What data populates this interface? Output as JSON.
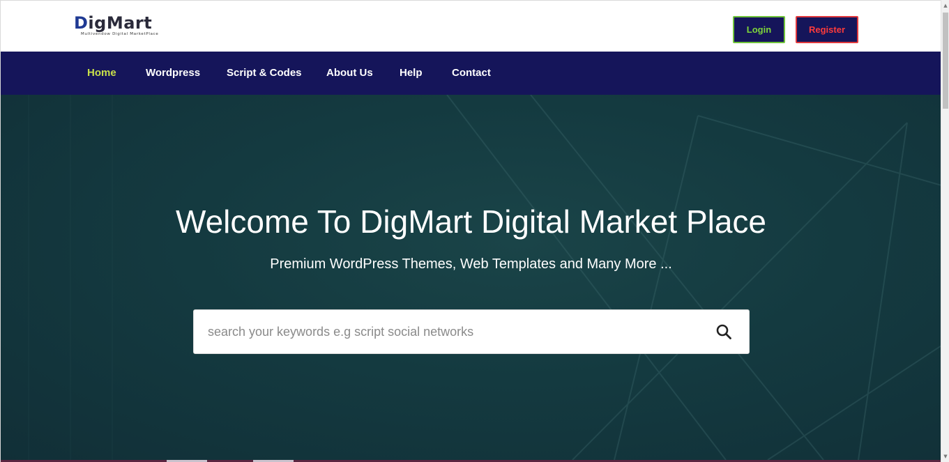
{
  "header": {
    "logo_text_first": "D",
    "logo_text_rest": "igMart",
    "logo_tagline": "Multivendow Digital MarketPlace",
    "login_label": "Login",
    "register_label": "Register"
  },
  "nav": {
    "items": [
      {
        "label": "Home",
        "active": true
      },
      {
        "label": "Wordpress",
        "active": false
      },
      {
        "label": "Script & Codes",
        "active": false
      },
      {
        "label": "About Us",
        "active": false
      },
      {
        "label": "Help",
        "active": false
      },
      {
        "label": "Contact",
        "active": false
      }
    ]
  },
  "hero": {
    "title": "Welcome To DigMart Digital Market Place",
    "subtitle": "Premium WordPress Themes, Web Templates and Many More ..."
  },
  "search": {
    "placeholder": "search your keywords e.g script social networks",
    "icon": "search-icon"
  },
  "colors": {
    "navy": "#15155a",
    "active_nav": "#c8e04a",
    "login_green": "#7fd63a",
    "register_red": "#ff3b3b",
    "hero_bg": "#143a40"
  }
}
